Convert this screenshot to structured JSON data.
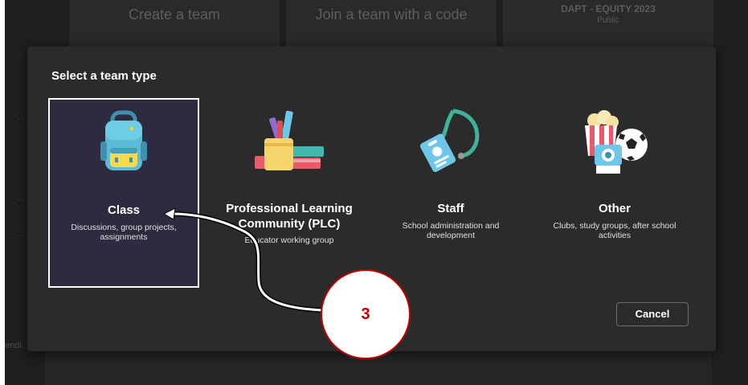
{
  "background": {
    "cards": [
      "Create a team",
      "Join a team with a code"
    ],
    "team_card": {
      "title": "DAPT - EQUITY 2023",
      "subtitle": "Public"
    },
    "dots": "..",
    "left_text": "endi..."
  },
  "dialog": {
    "title": "Select a team type",
    "types": [
      {
        "name": "Class",
        "description": "Discussions, group projects, assignments",
        "icon": "backpack-icon",
        "selected": true
      },
      {
        "name": "Professional Learning Community (PLC)",
        "description": "Educator working group",
        "icon": "books-pencils-icon",
        "selected": false
      },
      {
        "name": "Staff",
        "description": "School administration and development",
        "icon": "lanyard-badge-icon",
        "selected": false
      },
      {
        "name": "Other",
        "description": "Clubs, study groups, after school activities",
        "icon": "popcorn-camera-ball-icon",
        "selected": false
      }
    ],
    "cancel_label": "Cancel"
  },
  "annotation": {
    "step": "3"
  },
  "colors": {
    "backdrop": "#1f1f1f",
    "dialog": "#2b2b2b",
    "selected_card": "#2e2b40",
    "annotation_red": "#c00000"
  }
}
